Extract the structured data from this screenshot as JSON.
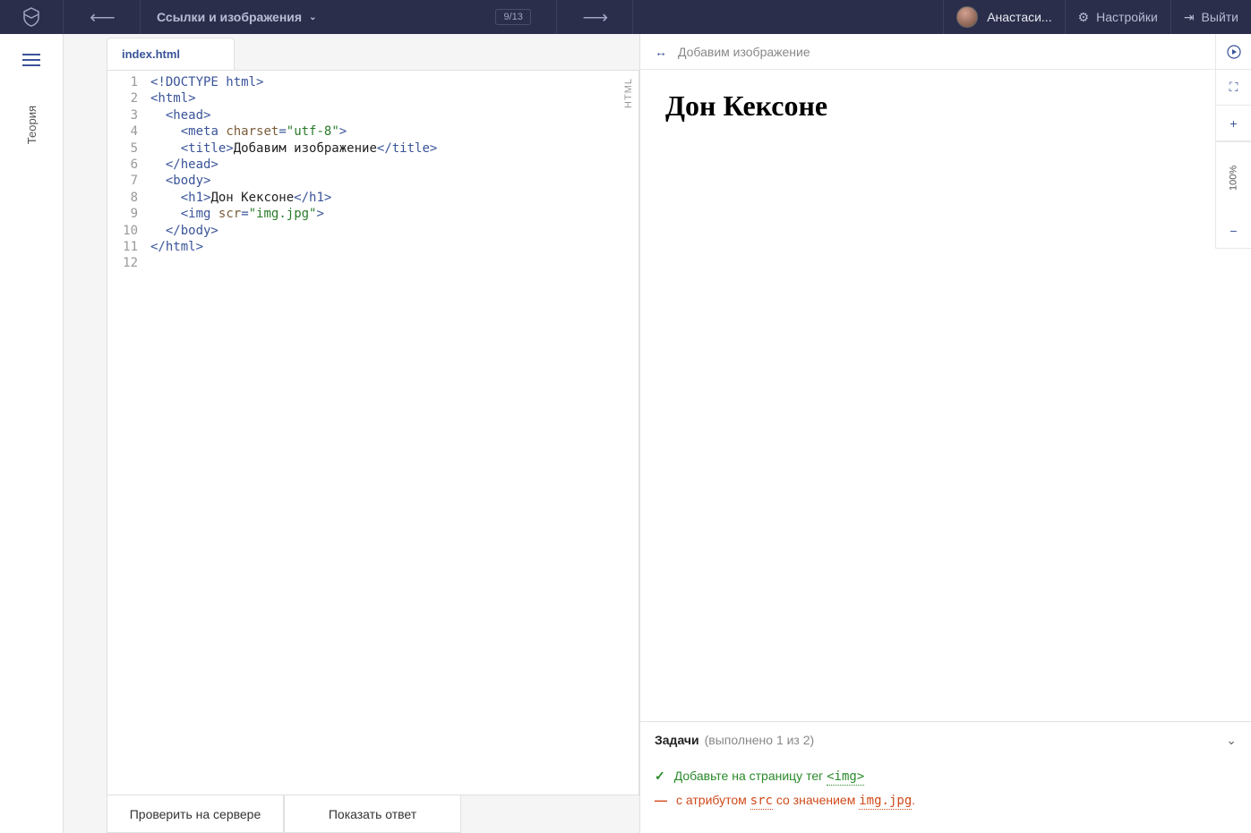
{
  "header": {
    "lesson_title": "Ссылки и изображения",
    "progress": "9/13",
    "user_name": "Анастаси...",
    "settings_label": "Настройки",
    "logout_label": "Выйти"
  },
  "sidebar": {
    "theory_label": "Теория"
  },
  "editor": {
    "tab_name": "index.html",
    "badge": "HTML",
    "check_button": "Проверить на сервере",
    "show_answer_button": "Показать ответ",
    "line_count": 12,
    "code": {
      "l1_doctype": "<!DOCTYPE html>",
      "l2_html_open": "<html>",
      "l3_head_open": "<head>",
      "l4_meta_tag": "meta",
      "l4_meta_attr": "charset",
      "l4_meta_val": "\"utf-8\"",
      "l5_title_open": "<title>",
      "l5_title_text": "Добавим изображение",
      "l5_title_close": "</title>",
      "l6_head_close": "</head>",
      "l7_body_open": "<body>",
      "l8_h1_open": "<h1>",
      "l8_h1_text": "Дон Кексоне",
      "l8_h1_close": "</h1>",
      "l9_img_tag": "img",
      "l9_img_attr": "scr",
      "l9_img_val": "\"img.jpg\"",
      "l10_body_close": "</body>",
      "l11_html_close": "</html>"
    }
  },
  "preview": {
    "title_text": "Добавим изображение",
    "heading": "Дон Кексоне",
    "zoom_label": "100%"
  },
  "tasks": {
    "title": "Задачи",
    "progress_text": "(выполнено 1 из 2)",
    "item1_prefix": "Добавьте на страницу тег ",
    "item1_code": "<img>",
    "item2_prefix": "с атрибутом ",
    "item2_code1": "src",
    "item2_mid": " со значением ",
    "item2_code2": "img.jpg",
    "item2_suffix": "."
  }
}
